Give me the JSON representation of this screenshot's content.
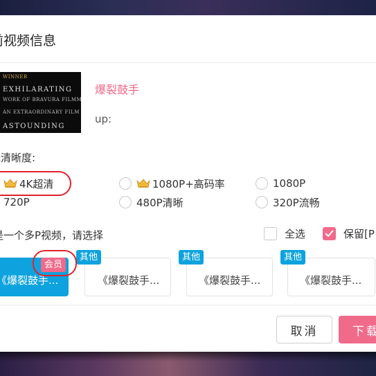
{
  "dialog": {
    "title": "前视频信息"
  },
  "video": {
    "title": "爆裂鼓手",
    "up_label": "up:",
    "poster_lines": [
      "WINNER",
      "EXHILARATING",
      "WORK OF BRAVURA FILMMAKING",
      "AN EXTRAORDINARY FILM",
      "ASTOUNDING"
    ]
  },
  "quality": {
    "label": "择清晰度:",
    "options": [
      {
        "label": "4K超清",
        "vip": true,
        "selected": false
      },
      {
        "label": "1080P+高码率",
        "vip": true,
        "selected": false
      },
      {
        "label": "1080P",
        "vip": false,
        "selected": false
      },
      {
        "label": "720P",
        "vip": false,
        "selected": false
      },
      {
        "label": "480P清晰",
        "vip": false,
        "selected": false
      },
      {
        "label": "320P流畅",
        "vip": false,
        "selected": false
      }
    ]
  },
  "multi_part": {
    "label": "是一个多P视频，请选择",
    "select_all": {
      "label": "全选",
      "checked": false
    },
    "keep": {
      "label": "保留[P",
      "checked": true
    }
  },
  "parts": [
    {
      "text": "《爆裂鼓手...",
      "badge": "会员",
      "selected": true
    },
    {
      "text": "《爆裂鼓手...",
      "badge": "其他",
      "selected": false
    },
    {
      "text": "《爆裂鼓手...",
      "badge": "其他",
      "selected": false
    },
    {
      "text": "《爆裂鼓手...",
      "badge": "其他",
      "selected": false
    }
  ],
  "buttons": {
    "cancel": "取消",
    "download": "下载"
  },
  "colors": {
    "accent_pink": "#f06a8a",
    "accent_blue": "#0ea3de",
    "highlight_red": "#e0222b"
  }
}
